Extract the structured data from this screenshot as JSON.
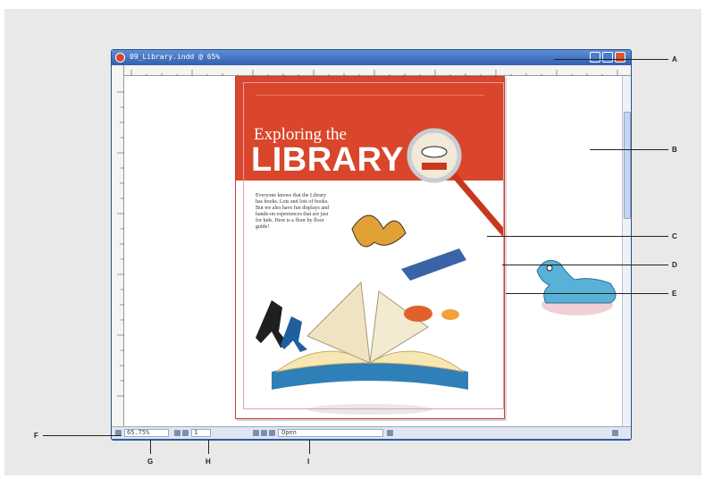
{
  "window": {
    "title": "09_Library.indd @ 65%"
  },
  "document": {
    "headline_line1": "Exploring the",
    "headline_line2": "LIBRARY",
    "intro_text": "Everyone knows that the Library has books. Lots and lots of books. But we also have fun displays and hands-on experiences that are just for kids. Here is a floor by floor guide!"
  },
  "statusbar": {
    "zoom": "65.75%",
    "page_number": "1",
    "preflight_status": "Open"
  },
  "callouts": [
    "A",
    "B",
    "C",
    "D",
    "E",
    "F",
    "G",
    "H",
    "I"
  ],
  "colors": {
    "window_frame": "#3567b4",
    "title_bar": "#2f5fae",
    "cover_red": "#d9462b",
    "page_bg": "#ffffff",
    "panel_bg": "#e9e9e7"
  }
}
